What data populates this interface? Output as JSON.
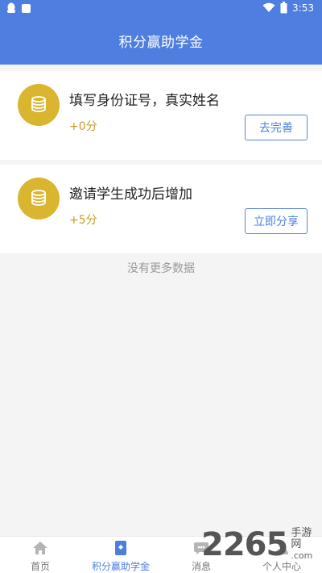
{
  "status_bar": {
    "time": "3:53"
  },
  "header": {
    "title": "积分赢助学金"
  },
  "tasks": [
    {
      "title": "填写身份证号，真实姓名",
      "points": "+0分",
      "action": "去完善"
    },
    {
      "title": "邀请学生成功后增加",
      "points": "+5分",
      "action": "立即分享"
    }
  ],
  "footer_text": "没有更多数据",
  "tabbar": {
    "tabs": [
      {
        "label": "首页",
        "icon": "home-icon"
      },
      {
        "label": "积分赢助学金",
        "icon": "points-icon",
        "active": true
      },
      {
        "label": "消息",
        "icon": "message-icon"
      },
      {
        "label": "个人中心",
        "icon": "profile-icon"
      }
    ]
  },
  "watermark": {
    "number": "2265",
    "text_cn": "手游网",
    "text_domain": ".com"
  },
  "colors": {
    "primary": "#4e7fe0",
    "coin": "#d9b530",
    "points": "#c89b25",
    "background": "#f4f4f4"
  }
}
